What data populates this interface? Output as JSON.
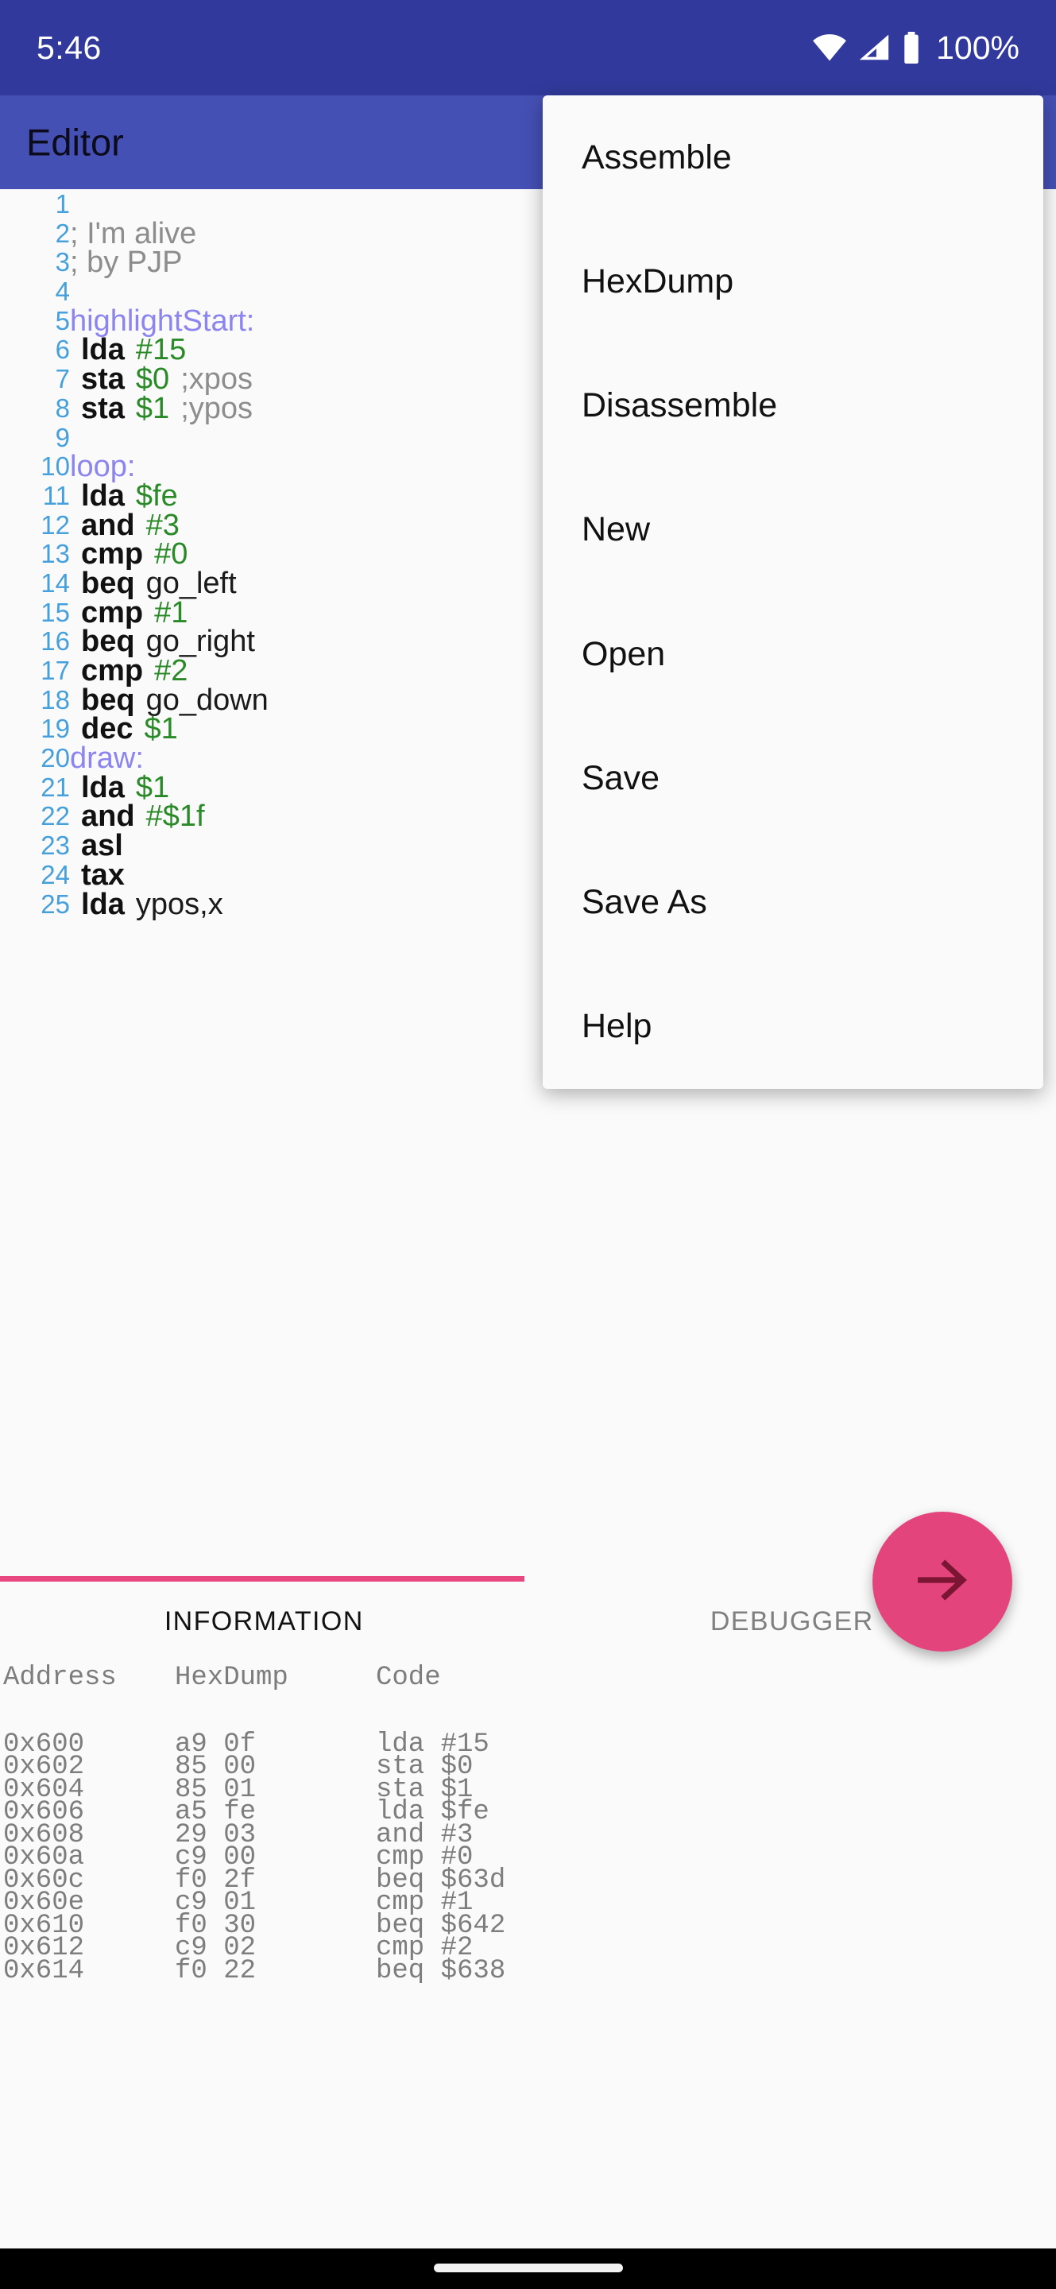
{
  "status_bar": {
    "time": "5:46",
    "battery_percent": "100%",
    "icons": [
      "wifi-icon",
      "signal-icon",
      "battery-icon"
    ]
  },
  "app_bar": {
    "title": "Editor",
    "background": "#4550b5"
  },
  "overflow_menu": {
    "items": [
      {
        "label": "Assemble"
      },
      {
        "label": "HexDump"
      },
      {
        "label": "Disassemble"
      },
      {
        "label": "New"
      },
      {
        "label": "Open"
      },
      {
        "label": "Save"
      },
      {
        "label": "Save As"
      },
      {
        "label": "Help"
      }
    ]
  },
  "editor": {
    "syntax_colors": {
      "line_number": "#46a0dc",
      "label": "#8c84ef",
      "mnemonic": "#111111",
      "operand": "#2a8a28",
      "comment": "#8d8d8d"
    },
    "lines": [
      {
        "n": "1",
        "tokens": []
      },
      {
        "n": "2",
        "tokens": [
          {
            "t": "; I'm alive",
            "k": "cm"
          }
        ]
      },
      {
        "n": "3",
        "tokens": [
          {
            "t": "; by PJP",
            "k": "cm"
          }
        ]
      },
      {
        "n": "4",
        "tokens": []
      },
      {
        "n": "5",
        "tokens": [
          {
            "t": "highlightStart:",
            "k": "lbl"
          }
        ]
      },
      {
        "n": "6",
        "tokens": [
          {
            "t": " ",
            "k": "sp"
          },
          {
            "t": "lda",
            "k": "mn"
          },
          {
            "t": " ",
            "k": "sp"
          },
          {
            "t": "#15",
            "k": "op"
          }
        ]
      },
      {
        "n": "7",
        "tokens": [
          {
            "t": " ",
            "k": "sp"
          },
          {
            "t": "sta",
            "k": "mn"
          },
          {
            "t": " ",
            "k": "sp"
          },
          {
            "t": "$0",
            "k": "op"
          },
          {
            "t": " ",
            "k": "sp"
          },
          {
            "t": ";xpos",
            "k": "cm"
          }
        ]
      },
      {
        "n": "8",
        "tokens": [
          {
            "t": " ",
            "k": "sp"
          },
          {
            "t": "sta",
            "k": "mn"
          },
          {
            "t": " ",
            "k": "sp"
          },
          {
            "t": "$1",
            "k": "op"
          },
          {
            "t": " ",
            "k": "sp"
          },
          {
            "t": ";ypos",
            "k": "cm"
          }
        ]
      },
      {
        "n": "9",
        "tokens": []
      },
      {
        "n": "10",
        "tokens": [
          {
            "t": "loop:",
            "k": "lbl"
          }
        ]
      },
      {
        "n": "11",
        "tokens": [
          {
            "t": " ",
            "k": "sp"
          },
          {
            "t": "lda",
            "k": "mn"
          },
          {
            "t": " ",
            "k": "sp"
          },
          {
            "t": "$fe",
            "k": "op"
          }
        ]
      },
      {
        "n": "12",
        "tokens": [
          {
            "t": " ",
            "k": "sp"
          },
          {
            "t": "and",
            "k": "mn"
          },
          {
            "t": " ",
            "k": "sp"
          },
          {
            "t": "#3",
            "k": "op"
          }
        ]
      },
      {
        "n": "13",
        "tokens": [
          {
            "t": " ",
            "k": "sp"
          },
          {
            "t": "cmp",
            "k": "mn"
          },
          {
            "t": " ",
            "k": "sp"
          },
          {
            "t": "#0",
            "k": "op"
          }
        ]
      },
      {
        "n": "14",
        "tokens": [
          {
            "t": " ",
            "k": "sp"
          },
          {
            "t": "beq",
            "k": "mn"
          },
          {
            "t": " ",
            "k": "sp"
          },
          {
            "t": "go_left",
            "k": "plain"
          }
        ]
      },
      {
        "n": "15",
        "tokens": [
          {
            "t": " ",
            "k": "sp"
          },
          {
            "t": "cmp",
            "k": "mn"
          },
          {
            "t": " ",
            "k": "sp"
          },
          {
            "t": "#1",
            "k": "op"
          }
        ]
      },
      {
        "n": "16",
        "tokens": [
          {
            "t": " ",
            "k": "sp"
          },
          {
            "t": "beq",
            "k": "mn"
          },
          {
            "t": " ",
            "k": "sp"
          },
          {
            "t": "go_right",
            "k": "plain"
          }
        ]
      },
      {
        "n": "17",
        "tokens": [
          {
            "t": " ",
            "k": "sp"
          },
          {
            "t": "cmp",
            "k": "mn"
          },
          {
            "t": " ",
            "k": "sp"
          },
          {
            "t": "#2",
            "k": "op"
          }
        ]
      },
      {
        "n": "18",
        "tokens": [
          {
            "t": " ",
            "k": "sp"
          },
          {
            "t": "beq",
            "k": "mn"
          },
          {
            "t": " ",
            "k": "sp"
          },
          {
            "t": "go_down",
            "k": "plain"
          }
        ]
      },
      {
        "n": "19",
        "tokens": [
          {
            "t": " ",
            "k": "sp"
          },
          {
            "t": "dec",
            "k": "mn"
          },
          {
            "t": " ",
            "k": "sp"
          },
          {
            "t": "$1",
            "k": "op"
          }
        ]
      },
      {
        "n": "20",
        "tokens": [
          {
            "t": "draw:",
            "k": "lbl"
          }
        ]
      },
      {
        "n": "21",
        "tokens": [
          {
            "t": " ",
            "k": "sp"
          },
          {
            "t": "lda",
            "k": "mn"
          },
          {
            "t": " ",
            "k": "sp"
          },
          {
            "t": "$1",
            "k": "op"
          }
        ]
      },
      {
        "n": "22",
        "tokens": [
          {
            "t": " ",
            "k": "sp"
          },
          {
            "t": "and",
            "k": "mn"
          },
          {
            "t": " ",
            "k": "sp"
          },
          {
            "t": "#$1f",
            "k": "op"
          }
        ]
      },
      {
        "n": "23",
        "tokens": [
          {
            "t": " ",
            "k": "sp"
          },
          {
            "t": "asl",
            "k": "mn"
          }
        ]
      },
      {
        "n": "24",
        "tokens": [
          {
            "t": " ",
            "k": "sp"
          },
          {
            "t": "tax",
            "k": "mn"
          }
        ]
      },
      {
        "n": "25",
        "tokens": [
          {
            "t": " ",
            "k": "sp"
          },
          {
            "t": "lda",
            "k": "mn"
          },
          {
            "t": " ",
            "k": "sp"
          },
          {
            "t": "ypos,x",
            "k": "plain"
          }
        ]
      }
    ]
  },
  "tabs": {
    "items": [
      {
        "label": "INFORMATION",
        "active": true
      },
      {
        "label": "DEBUGGER",
        "active": false
      }
    ],
    "indicator_color": "#e8477f"
  },
  "fab": {
    "icon": "arrow-right-icon",
    "background": "#e3447c",
    "icon_color": "#7a1633"
  },
  "info_panel": {
    "headers": [
      "Address",
      "HexDump",
      "Code"
    ],
    "rows": [
      {
        "address": "0x600",
        "hexdump": "a9 0f",
        "code": "lda #15"
      },
      {
        "address": "0x602",
        "hexdump": "85 00",
        "code": "sta $0"
      },
      {
        "address": "0x604",
        "hexdump": "85 01",
        "code": "sta $1"
      },
      {
        "address": "0x606",
        "hexdump": "a5 fe",
        "code": "lda $fe"
      },
      {
        "address": "0x608",
        "hexdump": "29 03",
        "code": "and #3"
      },
      {
        "address": "0x60a",
        "hexdump": "c9 00",
        "code": "cmp #0"
      },
      {
        "address": "0x60c",
        "hexdump": "f0 2f",
        "code": "beq $63d"
      },
      {
        "address": "0x60e",
        "hexdump": "c9 01",
        "code": "cmp #1"
      },
      {
        "address": "0x610",
        "hexdump": "f0 30",
        "code": "beq $642"
      },
      {
        "address": "0x612",
        "hexdump": "c9 02",
        "code": "cmp #2"
      },
      {
        "address": "0x614",
        "hexdump": "f0 22",
        "code": "beq $638"
      }
    ]
  },
  "nav_bar": {
    "home_indicator": "home-indicator"
  }
}
